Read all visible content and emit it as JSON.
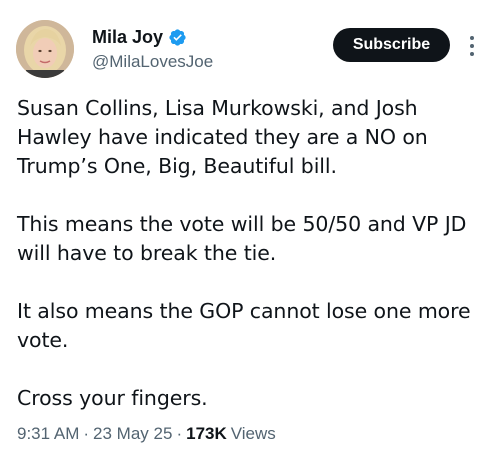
{
  "author": {
    "display_name": "Mila Joy",
    "handle": "@MilaLovesJoe",
    "verified": true
  },
  "subscribe_button": {
    "label": "Subscribe"
  },
  "tweet": {
    "paragraphs": [
      "Susan Collins, Lisa Murkowski, and Josh Hawley have indicated they are a NO on Trump’s One, Big, Beautiful bill.",
      "This means the vote will be 50/50 and VP JD will have to break the tie.",
      "It also means the GOP cannot lose one more vote.",
      "Cross your fingers."
    ]
  },
  "meta": {
    "time": "9:31 AM",
    "separator": "·",
    "date": "23 May 25",
    "views_count": "173K",
    "views_label": "Views"
  },
  "icons": {
    "verified": "verified-badge-icon",
    "more": "more-vertical-icon"
  },
  "colors": {
    "verified_blue": "#1d9bf0",
    "text_primary": "#0f1419",
    "text_secondary": "#536471",
    "button_bg": "#0f1419"
  }
}
